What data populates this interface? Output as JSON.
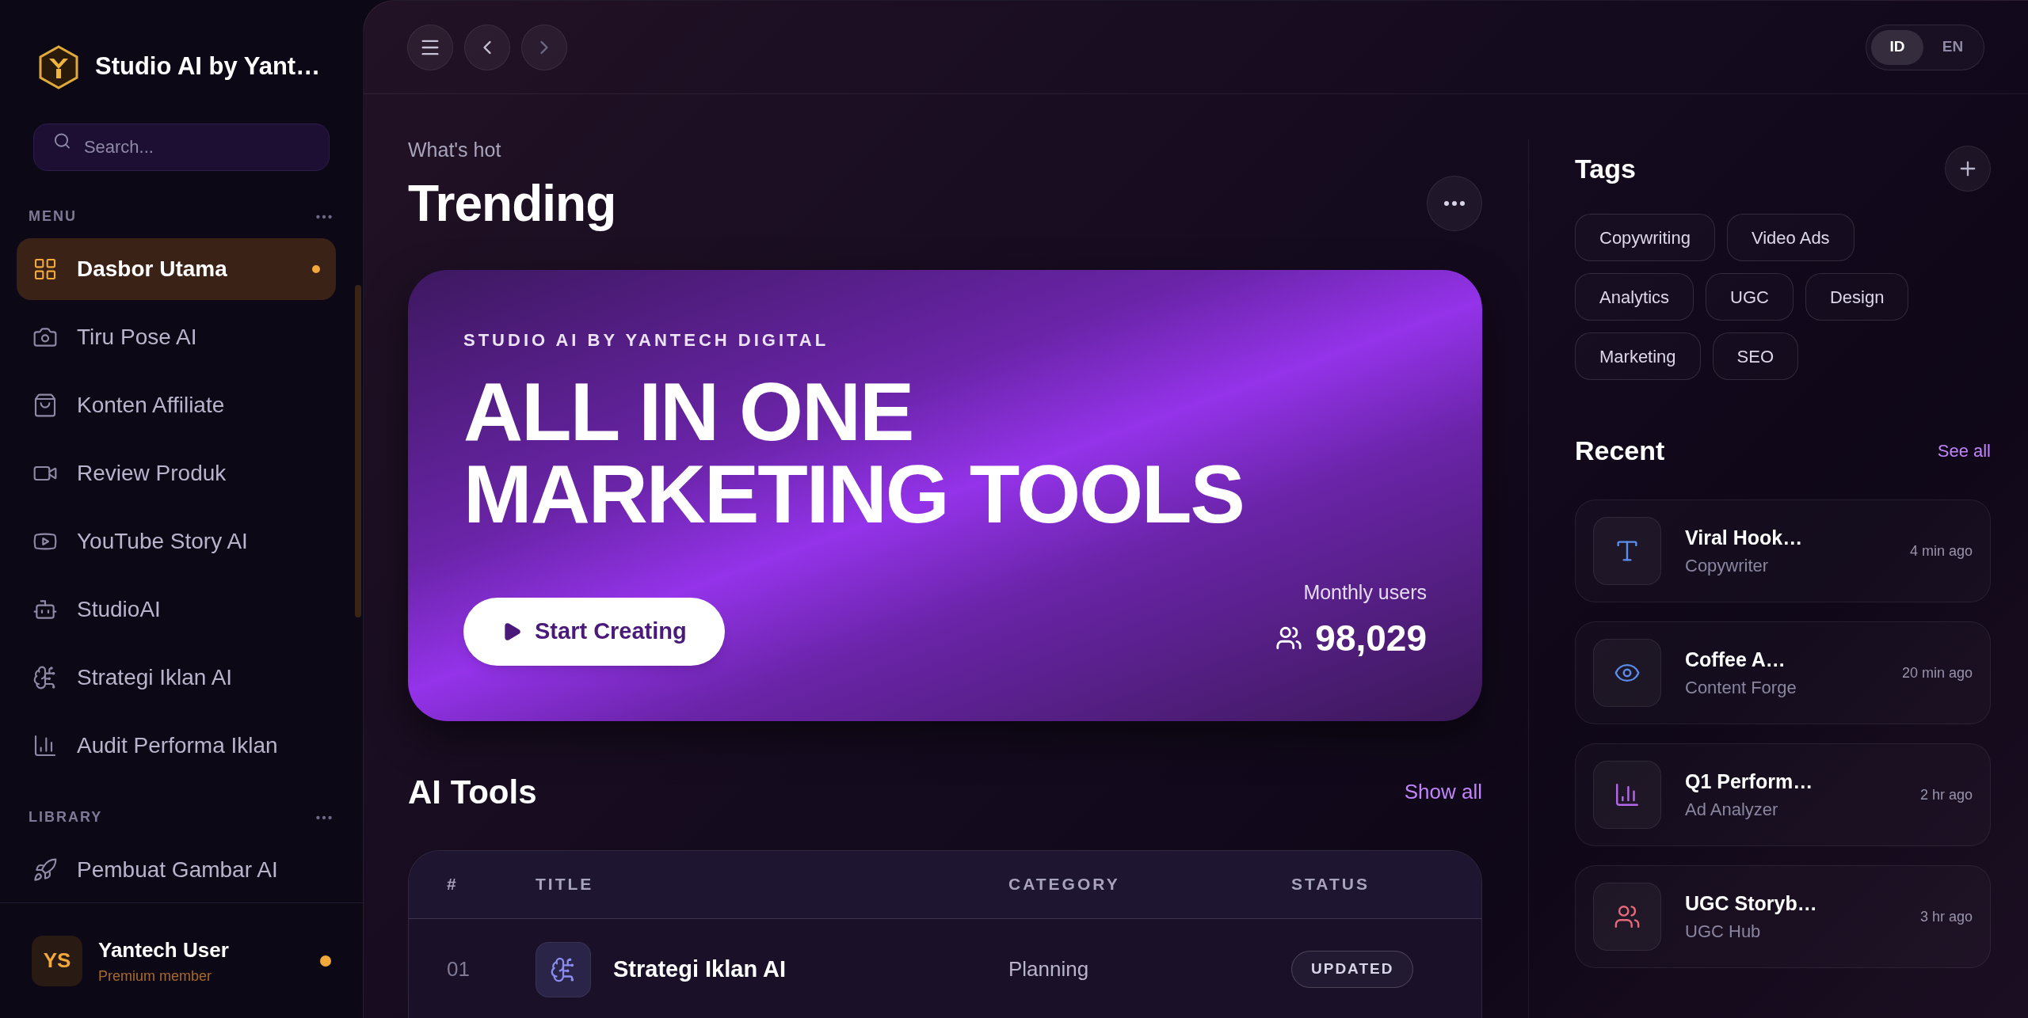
{
  "sidebar": {
    "brand": "Studio AI by Yant…",
    "search": {
      "placeholder": "Search..."
    },
    "sections": [
      {
        "label": "MENU",
        "items": [
          {
            "label": "Dasbor Utama",
            "selected": true
          },
          {
            "label": "Tiru Pose AI",
            "selected": false
          },
          {
            "label": "Konten Affiliate",
            "selected": false
          },
          {
            "label": "Review Produk",
            "selected": false
          },
          {
            "label": "YouTube Story AI",
            "selected": false
          },
          {
            "label": "StudioAI",
            "selected": false
          },
          {
            "label": "Strategi Iklan AI",
            "selected": false
          },
          {
            "label": "Audit Performa Iklan",
            "selected": false
          }
        ]
      },
      {
        "label": "LIBRARY",
        "items": [
          {
            "label": "Pembuat Gambar AI",
            "selected": false
          }
        ]
      }
    ],
    "user": {
      "initials": "YS",
      "name": "Yantech User",
      "plan": "Premium member"
    }
  },
  "languages": [
    {
      "label": "ID",
      "selected": true
    },
    {
      "label": "EN",
      "selected": false
    }
  ],
  "trending": {
    "eyebrow": "What's hot",
    "title": "Trending"
  },
  "banner": {
    "kicker": "STUDIO AI BY YANTECH DIGITAL",
    "headline": [
      "ALL IN ONE",
      "MARKETING TOOLS"
    ],
    "button": "Start Creating",
    "stat_label": "Monthly users",
    "stat_value": "98,029"
  },
  "tools": {
    "title": "AI Tools",
    "link": "Show all",
    "columns": [
      "#",
      "TITLE",
      "CATEGORY",
      "STATUS"
    ],
    "rows": [
      {
        "number": "01",
        "title": "Strategi Iklan AI",
        "category": "Planning",
        "status": "UPDATED"
      }
    ]
  },
  "tags": {
    "title": "Tags",
    "items": [
      "Copywriting",
      "Video Ads",
      "Analytics",
      "UGC",
      "Design",
      "Marketing",
      "SEO"
    ]
  },
  "recent": {
    "title": "Recent",
    "link": "See all",
    "items": [
      {
        "title": "Viral Hook…",
        "subtitle": "Copywriter",
        "time": "4 min ago",
        "color": "#5b8def"
      },
      {
        "title": "Coffee A…",
        "subtitle": "Content Forge",
        "time": "20 min ago",
        "color": "#5b8def"
      },
      {
        "title": "Q1 Perform…",
        "subtitle": "Ad Analyzer",
        "time": "2 hr ago",
        "color": "#b569e8"
      },
      {
        "title": "UGC Storyb…",
        "subtitle": "UGC Hub",
        "time": "3 hr ago",
        "color": "#e86a7a"
      }
    ]
  }
}
